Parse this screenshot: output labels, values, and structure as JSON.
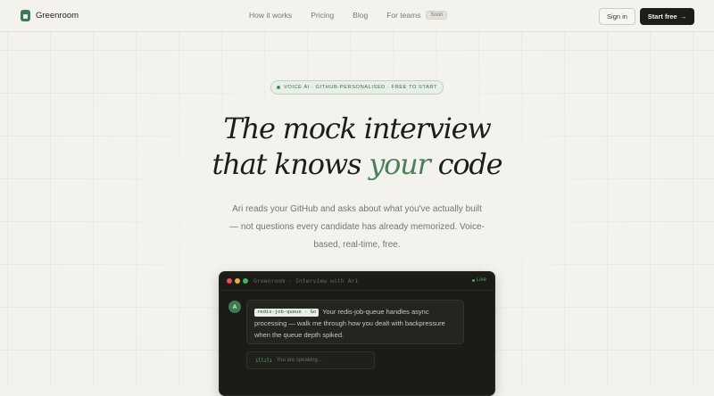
{
  "brand": {
    "name": "Greenroom",
    "accent": "#3e7a52"
  },
  "nav": {
    "links": [
      "How it works",
      "Pricing",
      "Blog",
      "For teams"
    ],
    "soon_badge": "Soon",
    "signin_label": "Sign in",
    "start_label": "Start free",
    "start_arrow": "→"
  },
  "hero": {
    "pill_text": "VOICE AI · GITHUB-PERSONALISED · FREE TO START",
    "headline_line1": "The mock interview",
    "headline_line2_pre": "that knows ",
    "headline_accent": "your",
    "headline_line2_post": " code",
    "subtext": "Ari reads your GitHub and asks about what you've actually built — not questions every candidate has already memorized. Voice-based, real-time, free."
  },
  "terminal": {
    "title": "Greenroom · Interview with Ari",
    "status": "Live",
    "avatar_initial": "A",
    "repo_tag": "redis-job-queue · Go",
    "message": "Your redis-job-queue handles async processing — walk me through how you dealt with backpressure when the queue depth spiked.",
    "wave_glyph": "ıllılı",
    "speaking_text": "You are speaking..."
  },
  "colors": {
    "background": "#f4f2ec",
    "accent_green": "#4b805a",
    "terminal_bg": "#1b1b17"
  }
}
